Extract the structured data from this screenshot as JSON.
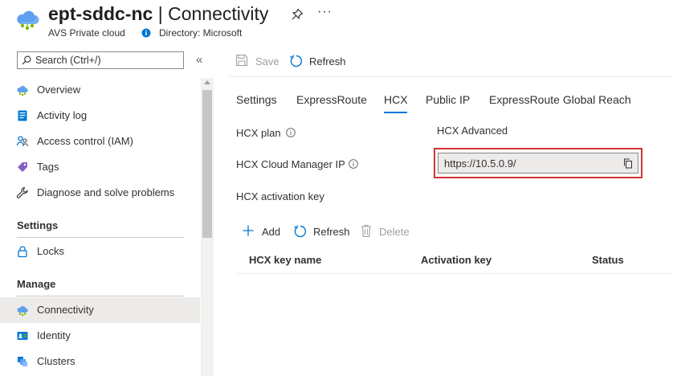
{
  "header": {
    "resource_name": "ept-sddc-nc",
    "separator": " | ",
    "page_name": "Connectivity",
    "resource_type": "AVS Private cloud",
    "directory": "Directory: Microsoft",
    "icons": {
      "app": "cloud-icon",
      "pin": "pin-icon",
      "more": "more-icon",
      "info": "info-icon"
    },
    "more_glyph": "···"
  },
  "sidebar": {
    "search": {
      "placeholder": "Search (Ctrl+/)"
    },
    "collapse_glyph": "«",
    "items": [
      {
        "label": "Overview",
        "icon": "cloud-icon"
      },
      {
        "label": "Activity log",
        "icon": "activity-log-icon"
      },
      {
        "label": "Access control (IAM)",
        "icon": "people-icon"
      },
      {
        "label": "Tags",
        "icon": "tag-icon"
      },
      {
        "label": "Diagnose and solve problems",
        "icon": "wrench-icon"
      }
    ],
    "sections": [
      {
        "title": "Settings",
        "items": [
          {
            "label": "Locks",
            "icon": "lock-icon"
          }
        ]
      },
      {
        "title": "Manage",
        "items": [
          {
            "label": "Connectivity",
            "icon": "cloud-icon",
            "selected": true
          },
          {
            "label": "Identity",
            "icon": "identity-icon"
          },
          {
            "label": "Clusters",
            "icon": "clusters-icon"
          }
        ]
      }
    ]
  },
  "toolbar": {
    "save_label": "Save",
    "refresh_label": "Refresh"
  },
  "tabs": [
    {
      "label": "Settings"
    },
    {
      "label": "ExpressRoute"
    },
    {
      "label": "HCX",
      "active": true
    },
    {
      "label": "Public IP"
    },
    {
      "label": "ExpressRoute Global Reach"
    }
  ],
  "hcx": {
    "plan_label": "HCX plan",
    "plan_value": "HCX Advanced",
    "manager_ip_label": "HCX Cloud Manager IP",
    "manager_ip_value": "https://10.5.0.9/",
    "activation_key_label": "HCX activation key"
  },
  "keys_toolbar": {
    "add_label": "Add",
    "refresh_label": "Refresh",
    "delete_label": "Delete"
  },
  "table": {
    "columns": [
      "HCX key name",
      "Activation key",
      "Status"
    ],
    "rows": []
  },
  "colors": {
    "accent": "#0078d4",
    "highlight_border": "#d13438",
    "selected_bg": "#edebe9"
  }
}
